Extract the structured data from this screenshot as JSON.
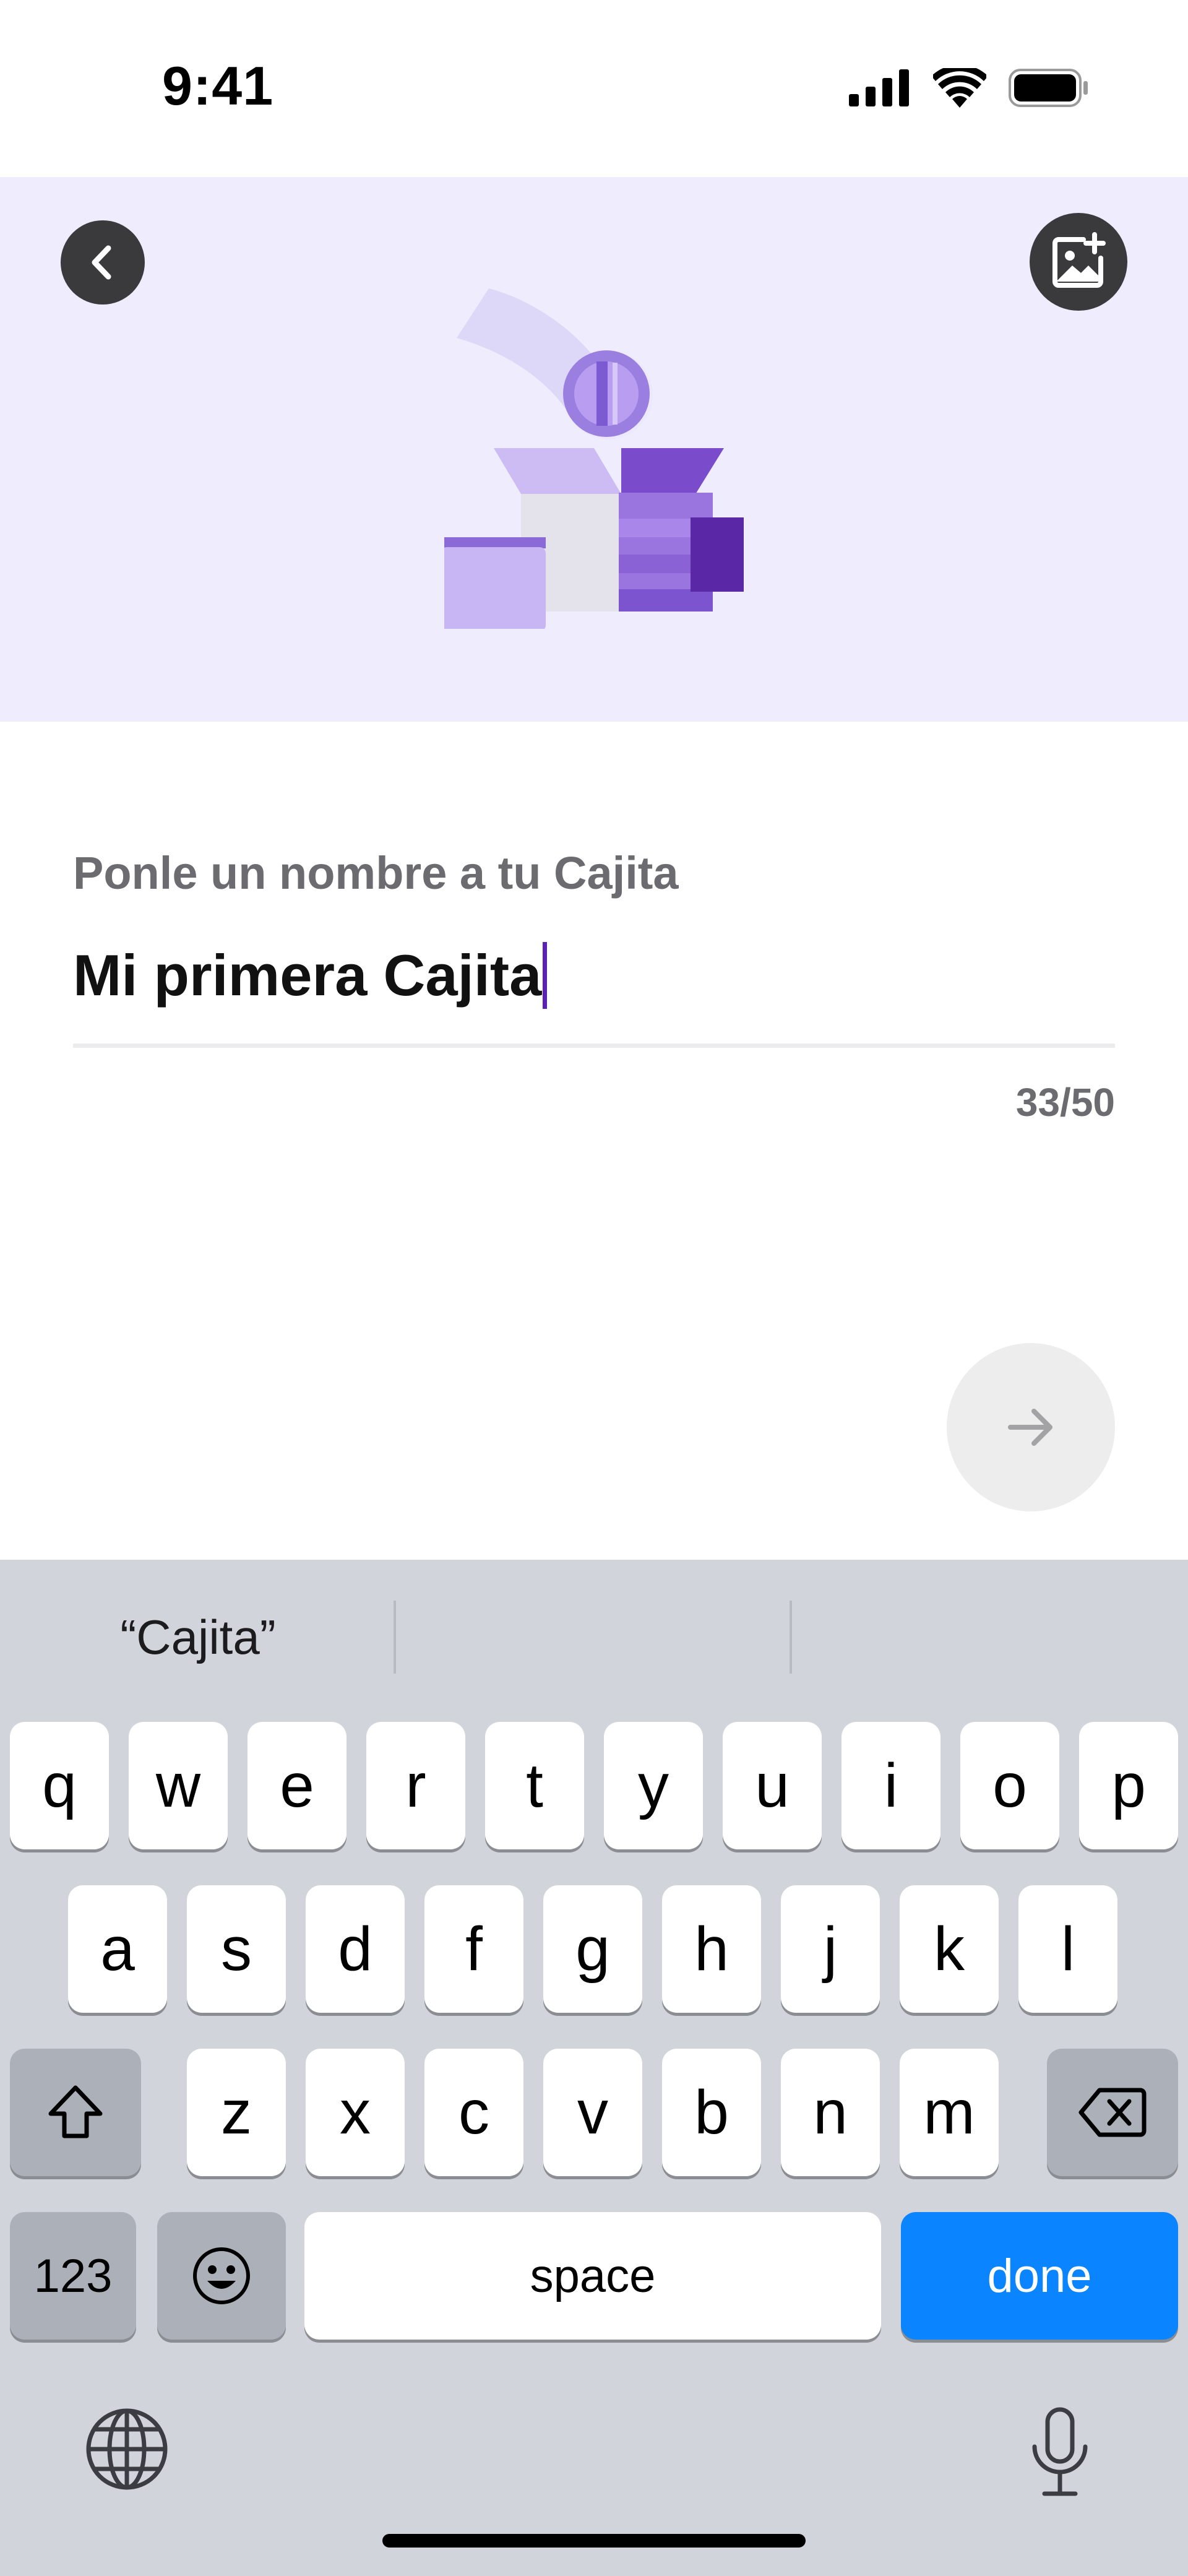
{
  "status_bar": {
    "time": "9:41",
    "icons": [
      "signal-icon",
      "wifi-icon",
      "battery-icon"
    ]
  },
  "header": {
    "back_icon": "chevron-left-icon",
    "add_image_icon": "add-image-icon"
  },
  "form": {
    "label": "Ponle un nombre a tu Cajita",
    "value": "Mi primera Cajita",
    "counter": "33/50",
    "next_icon": "arrow-right-icon"
  },
  "keyboard": {
    "suggestions": [
      "“Cajita”",
      "",
      ""
    ],
    "row1": [
      "q",
      "w",
      "e",
      "r",
      "t",
      "y",
      "u",
      "i",
      "o",
      "p"
    ],
    "row2": [
      "a",
      "s",
      "d",
      "f",
      "g",
      "h",
      "j",
      "k",
      "l"
    ],
    "row3": [
      "z",
      "x",
      "c",
      "v",
      "b",
      "n",
      "m"
    ],
    "numbers_label": "123",
    "space_label": "space",
    "done_label": "done"
  },
  "colors": {
    "hero_bg": "#eeecfd",
    "accent_purple": "#5b21b6",
    "done_blue": "#0a84ff"
  }
}
